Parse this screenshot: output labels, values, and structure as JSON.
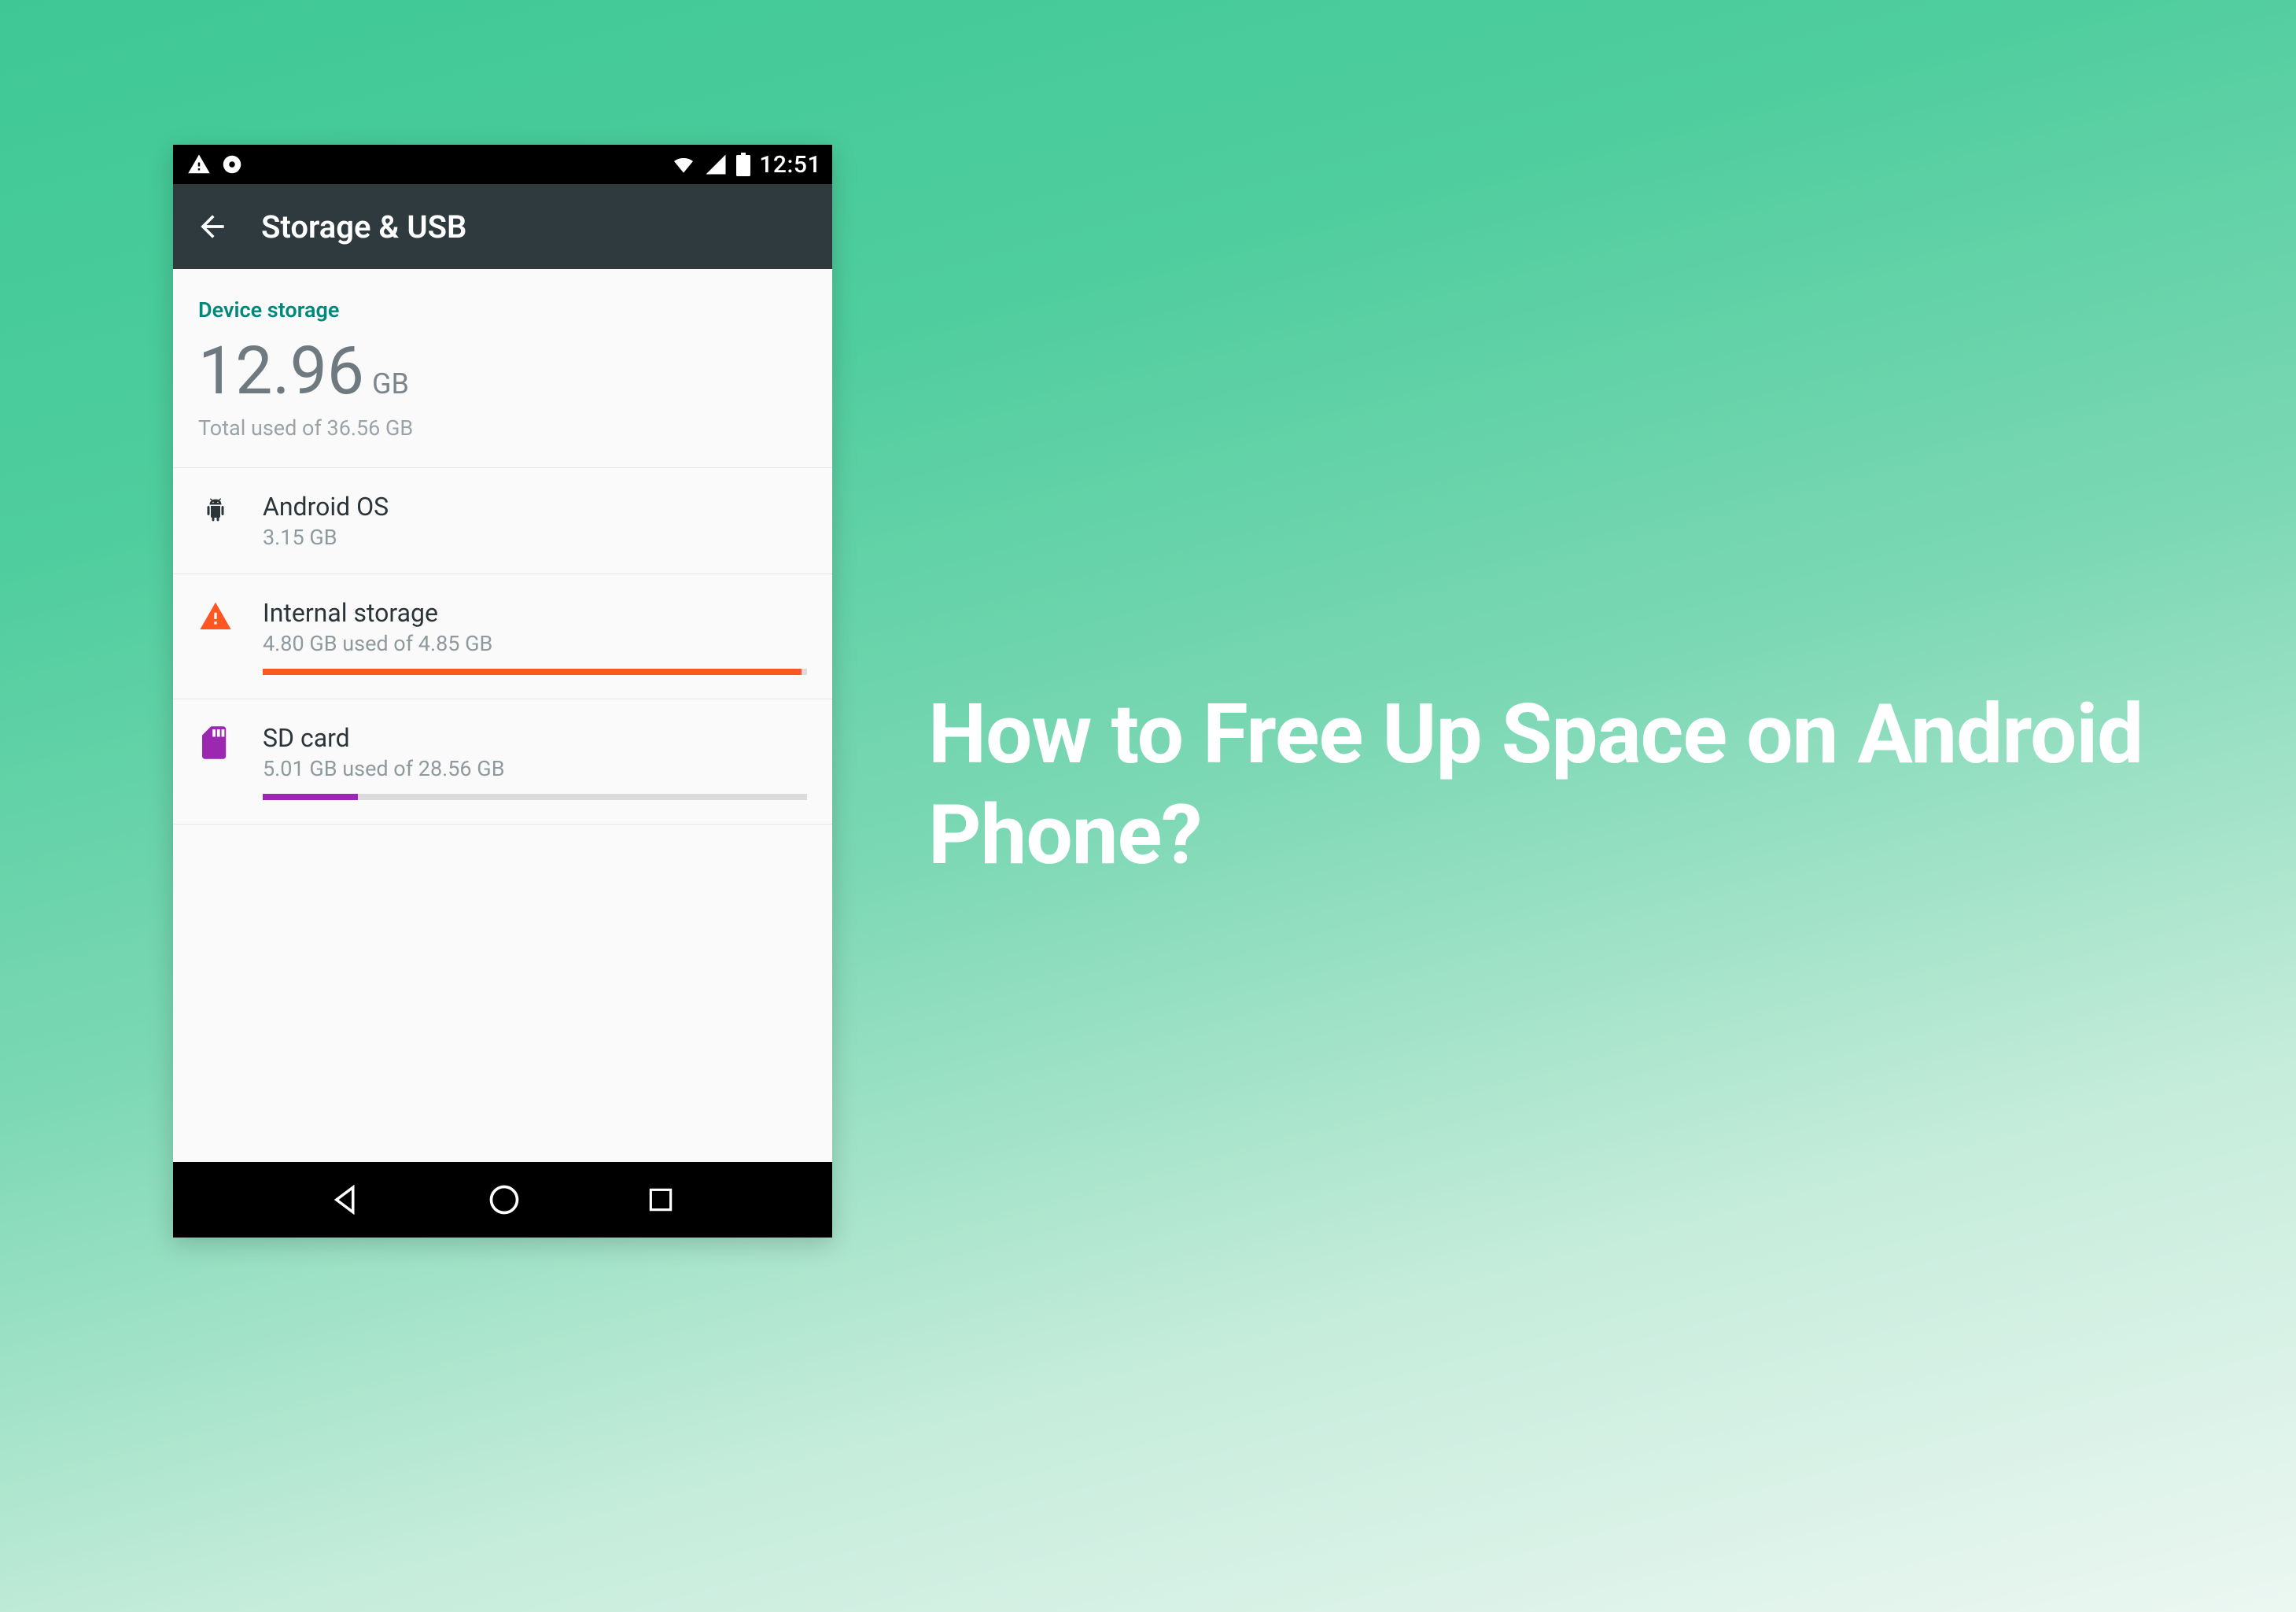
{
  "headline": "How to Free Up Space on Android Phone?",
  "statusBar": {
    "time": "12:51"
  },
  "appBar": {
    "title": "Storage & USB"
  },
  "sectionHeader": "Device storage",
  "summary": {
    "usedValue": "12.96",
    "usedUnit": "GB",
    "subText": "Total used of 36.56 GB"
  },
  "items": [
    {
      "title": "Android OS",
      "sub": "3.15 GB",
      "icon": "android",
      "progress": null
    },
    {
      "title": "Internal storage",
      "sub": "4.80 GB used of 4.85 GB",
      "icon": "warning",
      "progress": {
        "percent": 99,
        "color": "orange"
      }
    },
    {
      "title": "SD card",
      "sub": "5.01 GB used of 28.56 GB",
      "icon": "sd",
      "progress": {
        "percent": 17.5,
        "color": "purple"
      }
    }
  ]
}
